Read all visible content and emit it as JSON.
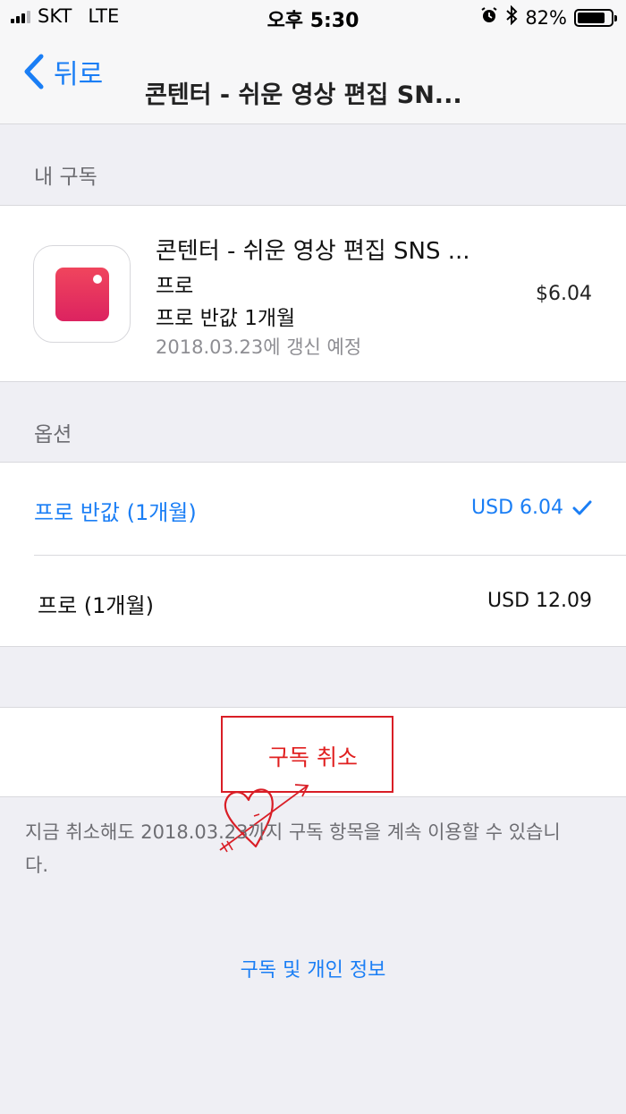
{
  "status_bar": {
    "carrier": "SKT",
    "network": "LTE",
    "time": "오후 5:30",
    "battery_percent_label": "82%",
    "battery_level": 0.82
  },
  "nav": {
    "back_label": "뒤로",
    "title": "콘텐터 - 쉬운 영상 편집 SN..."
  },
  "my_subscription": {
    "header": "내 구독",
    "app_name": "콘텐터 - 쉬운 영상 편집 SNS ...",
    "tier": "프로",
    "plan": "프로 반값 1개월",
    "renewal": "2018.03.23에 갱신 예정",
    "price": "$6.04"
  },
  "options": {
    "header": "옵션",
    "items": [
      {
        "label": "프로 반값 (1개월)",
        "price": "USD 6.04",
        "selected": true
      },
      {
        "label": "프로 (1개월)",
        "price": "USD 12.09",
        "selected": false
      }
    ]
  },
  "cancel": {
    "label": "구독 취소"
  },
  "footer": {
    "note": "지금 취소해도 2018.03.23까지 구독 항목을 계속 이용할 수 있습니다.",
    "privacy_link": "구독 및 개인 정보"
  },
  "colors": {
    "accent": "#1a7ef5",
    "destructive": "#e02020",
    "annotation": "#d91e26",
    "app_icon": "#e83a5e"
  }
}
